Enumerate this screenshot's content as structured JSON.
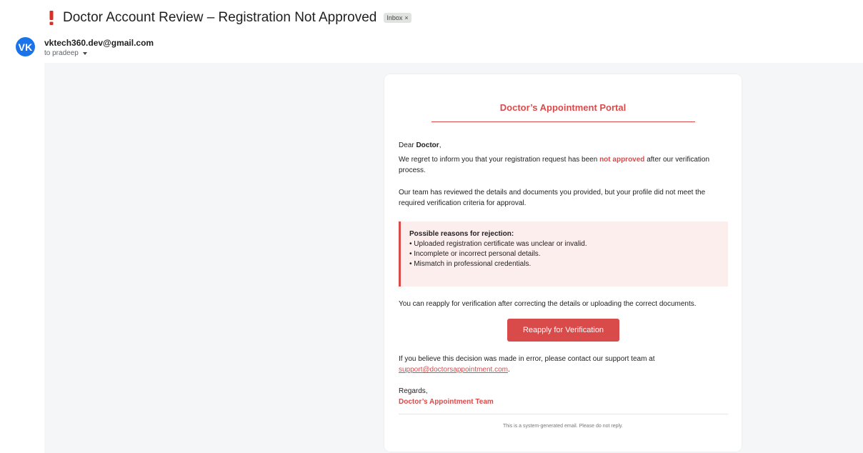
{
  "email": {
    "subject": "Doctor Account Review – Registration Not Approved",
    "label_chip": "Inbox",
    "label_chip_close": "×",
    "sender": {
      "avatar_initials": "VK",
      "avatar_color": "#1a73e8",
      "address": "vktech360.dev@gmail.com",
      "recipient_line": "to pradeep"
    },
    "important_color": "#d93025"
  },
  "message": {
    "portal_title": "Doctor’s Appointment Portal",
    "accent_color": "#d94b4b",
    "greeting_prefix": "Dear ",
    "greeting_name": "Doctor",
    "greeting_suffix": ",",
    "para1_before": "We regret to inform you that your registration request has been ",
    "para1_emphasis": "not approved",
    "para1_after": " after our verification process.",
    "para2": "Our team has reviewed the details and documents you provided, but your profile did not meet the required verification criteria for approval.",
    "reasons_heading": "Possible reasons for rejection:",
    "reasons": [
      "• Uploaded registration certificate was unclear or invalid.",
      "• Incomplete or incorrect personal details.",
      "• Mismatch in professional credentials."
    ],
    "reapply_text": "You can reapply for verification after correcting the details or uploading the correct documents.",
    "reapply_button": "Reapply for Verification",
    "support_text": "If you believe this decision was made in error, please contact our support team at",
    "support_email": "support@doctorsappointment.com",
    "support_suffix": ".",
    "regards": "Regards,",
    "team_name": "Doctor’s Appointment Team",
    "footer_note": "This is a system-generated email. Please do not reply."
  }
}
